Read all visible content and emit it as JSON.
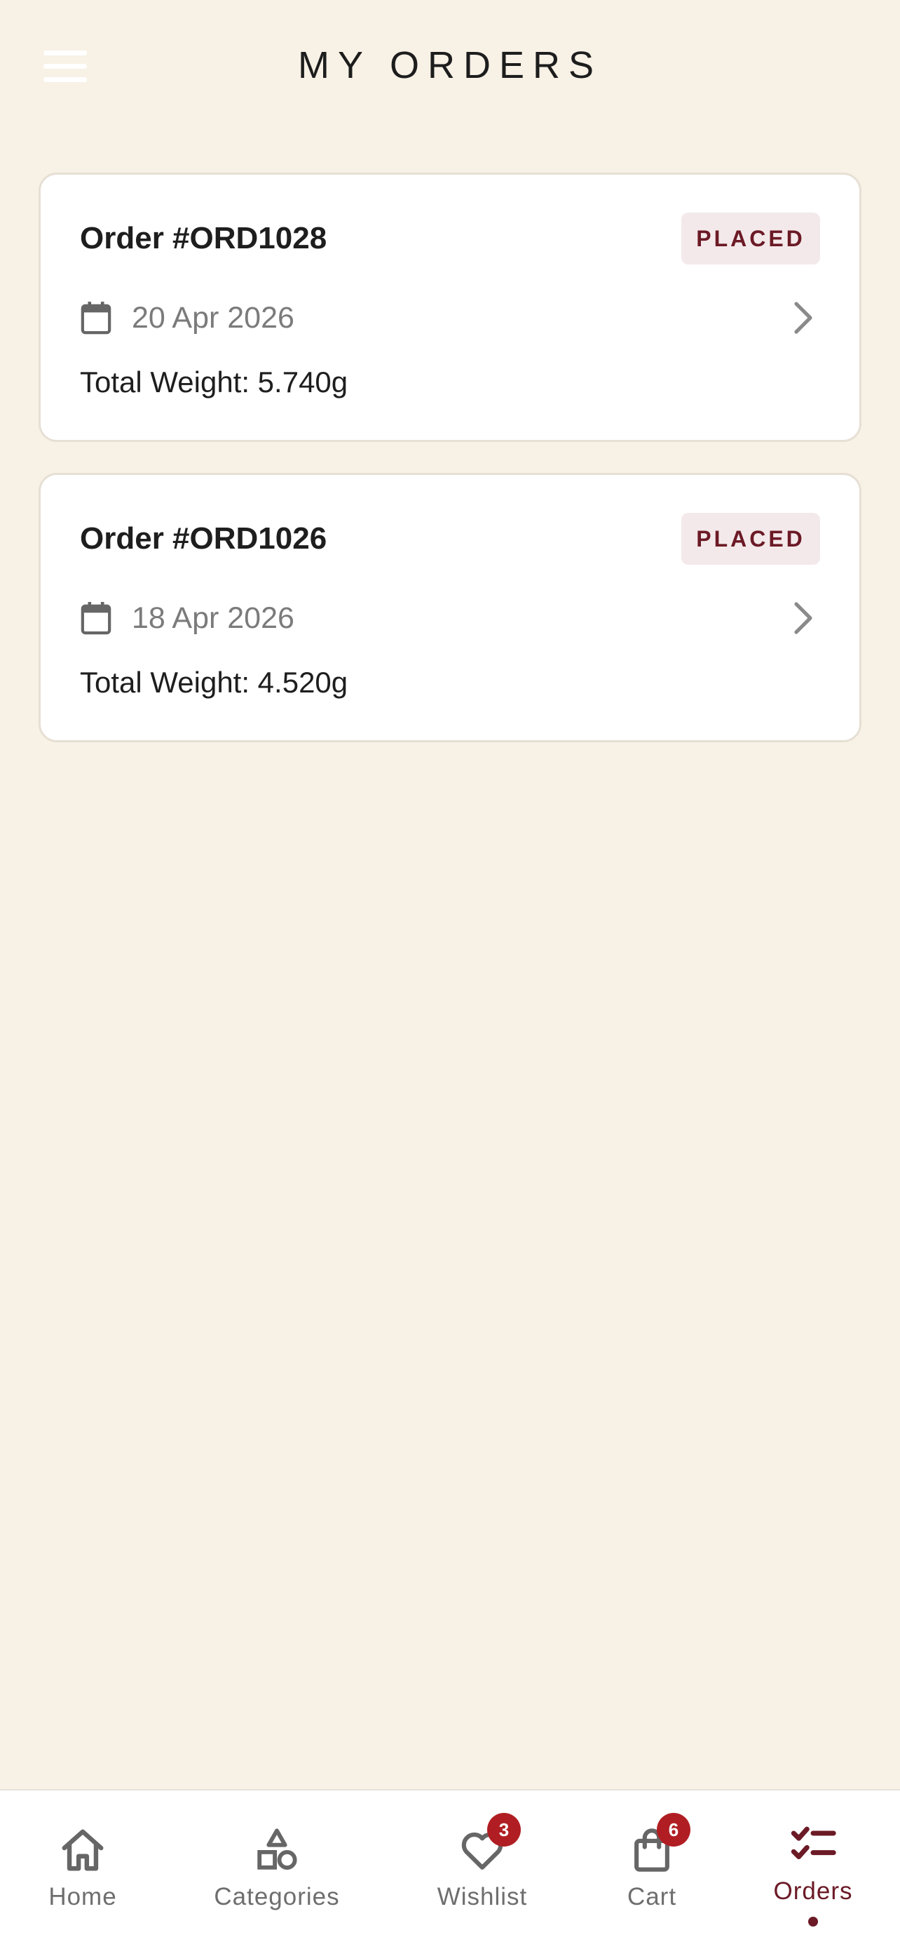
{
  "header": {
    "title": "MY ORDERS"
  },
  "orders": [
    {
      "title": "Order #ORD1028",
      "status": "PLACED",
      "date": "20 Apr 2026",
      "weight": "Total Weight: 5.740g"
    },
    {
      "title": "Order #ORD1026",
      "status": "PLACED",
      "date": "18 Apr 2026",
      "weight": "Total Weight: 4.520g"
    }
  ],
  "bottom_nav": {
    "items": [
      {
        "label": "Home",
        "icon": "home-icon"
      },
      {
        "label": "Categories",
        "icon": "categories-icon"
      },
      {
        "label": "Wishlist",
        "icon": "heart-icon",
        "badge": "3"
      },
      {
        "label": "Cart",
        "icon": "shopping-bag-icon",
        "badge": "6"
      },
      {
        "label": "Orders",
        "icon": "orders-checklist-icon",
        "active": true
      }
    ]
  },
  "colors": {
    "background": "#f8f1e6",
    "accent": "#6b1a26",
    "badge": "#b01e23",
    "badge_bg": "#f4e9ea"
  }
}
